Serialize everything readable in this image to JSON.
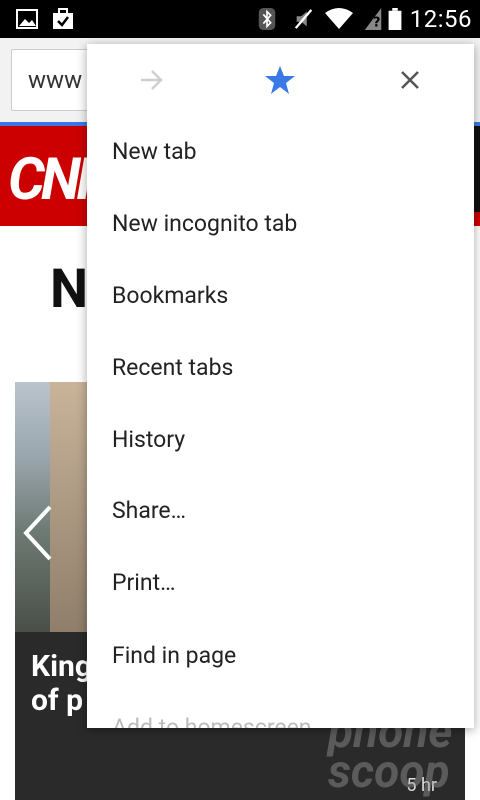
{
  "status_bar": {
    "time": "12:56"
  },
  "browser": {
    "url_prefix": "www"
  },
  "page": {
    "logo": "CNN",
    "headline_partial": "N",
    "caption_partial": "King\nof p",
    "timestamp": "5 hr"
  },
  "menu": {
    "items": [
      {
        "label": "New tab"
      },
      {
        "label": "New incognito tab"
      },
      {
        "label": "Bookmarks"
      },
      {
        "label": "Recent tabs"
      },
      {
        "label": "History"
      },
      {
        "label": "Share…"
      },
      {
        "label": "Print…"
      },
      {
        "label": "Find in page"
      },
      {
        "label": "Add to homescreen"
      }
    ]
  },
  "watermark": {
    "text": "phone\nscoop"
  },
  "colors": {
    "accent": "#3b78e7",
    "cnn_red": "#cc0000"
  }
}
